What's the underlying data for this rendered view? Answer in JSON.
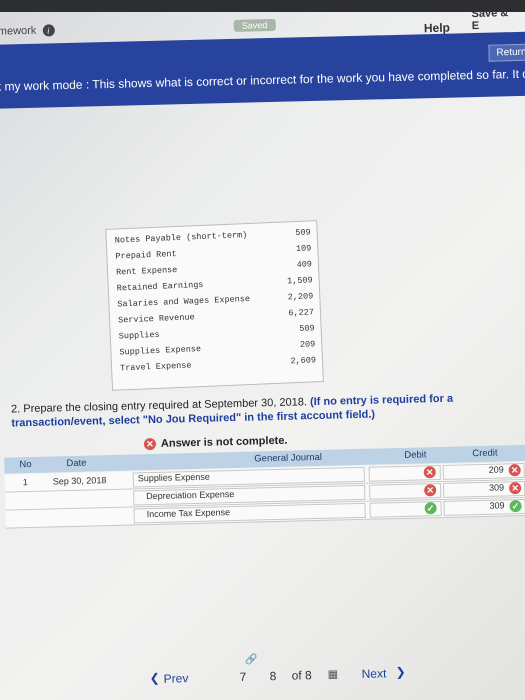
{
  "header": {
    "breadcrumb": "mework",
    "saved_label": "Saved",
    "help_label": "Help",
    "save_label": "Save & E",
    "return_label": "Return",
    "check_message": "k my work mode : This shows what is correct or incorrect for the work you have completed so far. It does not indicate comp"
  },
  "trial_balance": [
    {
      "account": "Notes Payable (short-term)",
      "amount": "509"
    },
    {
      "account": "Prepaid Rent",
      "amount": "109"
    },
    {
      "account": "Rent Expense",
      "amount": "409"
    },
    {
      "account": "Retained Earnings",
      "amount": "1,509"
    },
    {
      "account": "Salaries and Wages Expense",
      "amount": "2,209"
    },
    {
      "account": "Service Revenue",
      "amount": "6,227"
    },
    {
      "account": "Supplies",
      "amount": "509"
    },
    {
      "account": "Supplies Expense",
      "amount": "209"
    },
    {
      "account": "Travel Expense",
      "amount": "2,609"
    }
  ],
  "question": {
    "text": "2. Prepare the closing entry required at September 30, 2018.",
    "instruction": "(If no entry is required for a transaction/event, select \"No Jou Required\" in the first account field.)"
  },
  "status": "Answer is not complete.",
  "journal": {
    "headers": {
      "no": "No",
      "date": "Date",
      "general_journal": "General Journal",
      "debit": "Debit",
      "credit": "Credit"
    },
    "rows": [
      {
        "no": "1",
        "date": "Sep 30, 2018",
        "account": "Supplies Expense",
        "debit": "",
        "credit": "209",
        "debit_mark": "x",
        "credit_mark": "x"
      },
      {
        "no": "",
        "date": "",
        "account": "Depreciation Expense",
        "debit": "",
        "credit": "309",
        "debit_mark": "x",
        "credit_mark": "x"
      },
      {
        "no": "",
        "date": "",
        "account": "Income Tax Expense",
        "debit": "",
        "credit": "309",
        "debit_mark": "ok",
        "credit_mark": "ok"
      }
    ]
  },
  "pager": {
    "prev": "Prev",
    "current": "7",
    "next_page": "8",
    "of": "of 8",
    "next": "Next"
  },
  "colors": {
    "band": "#27439e",
    "header_blue": "#bdd2e5",
    "error": "#d9534f",
    "ok": "#5cb85c"
  }
}
